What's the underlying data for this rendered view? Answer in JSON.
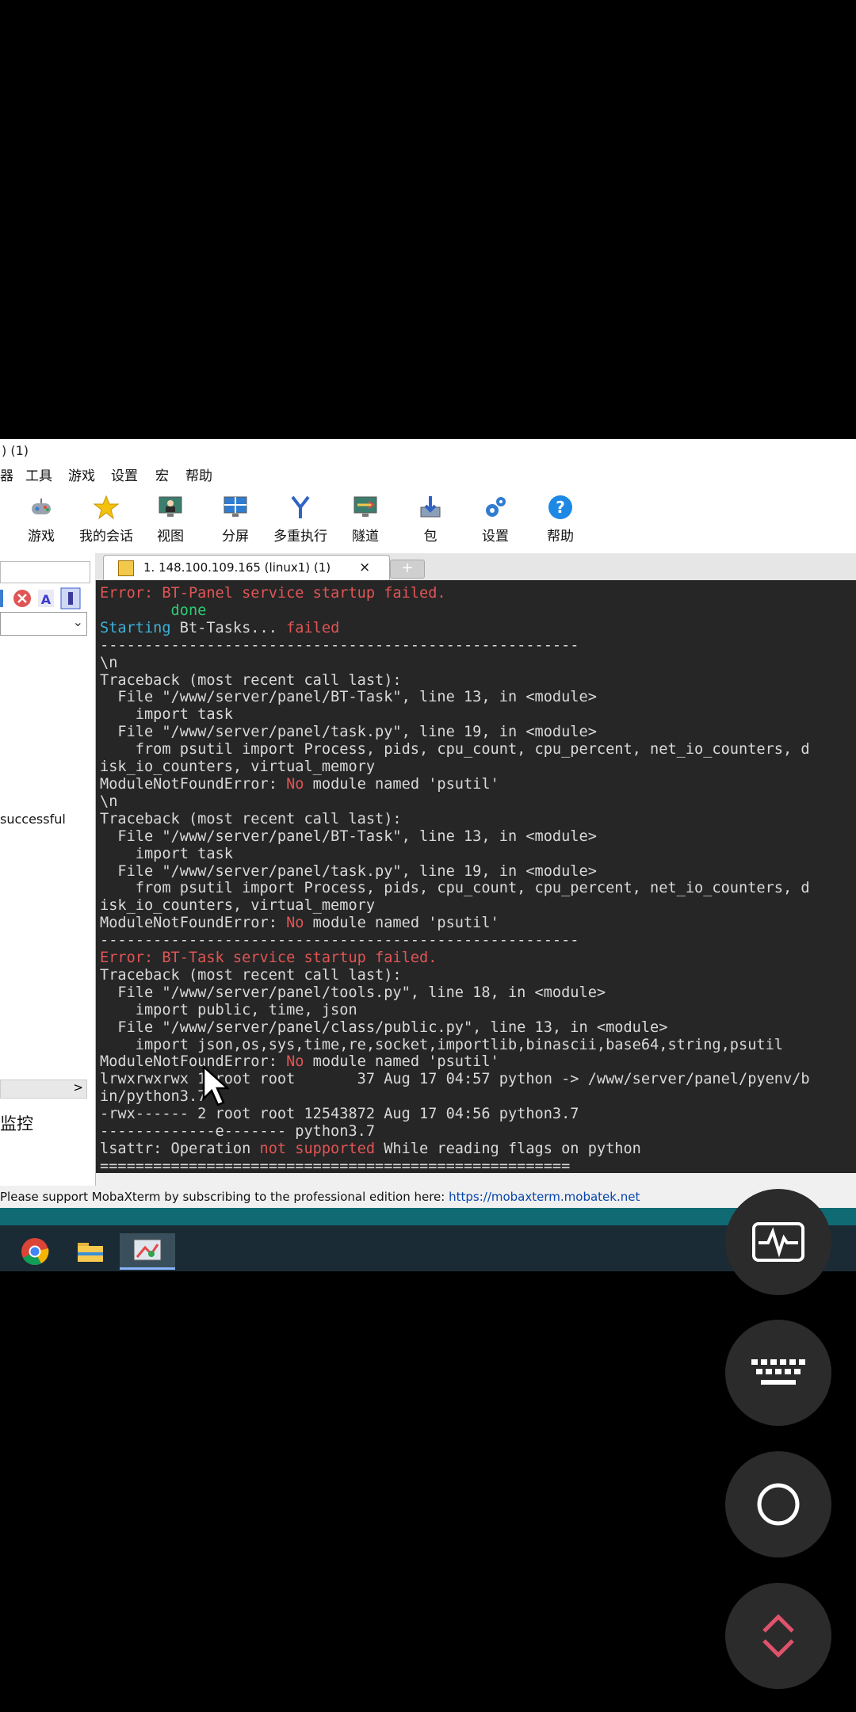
{
  "window": {
    "title": ") (1)"
  },
  "menu": [
    "器",
    "工具",
    "游戏",
    "设置",
    "宏",
    "帮助"
  ],
  "toolbar": [
    {
      "label": "游戏",
      "icon": "gamepad-icon"
    },
    {
      "label": "我的会话",
      "icon": "star-icon"
    },
    {
      "label": "视图",
      "icon": "monitor-user-icon"
    },
    {
      "label": "分屏",
      "icon": "split-screen-icon"
    },
    {
      "label": "多重执行",
      "icon": "fork-icon"
    },
    {
      "label": "隧道",
      "icon": "tunnel-icon"
    },
    {
      "label": "包",
      "icon": "package-icon"
    },
    {
      "label": "设置",
      "icon": "gears-icon"
    },
    {
      "label": "帮助",
      "icon": "help-icon"
    }
  ],
  "sidebar": {
    "status_text": "successful",
    "bottom_label": "监控",
    "scroll_arrow": ">"
  },
  "tabs": [
    {
      "label": "1. 148.100.109.165 (linux1) (1)",
      "close": "×"
    }
  ],
  "new_tab": "+",
  "terminal": {
    "lines": [
      [
        {
          "t": "Error: BT-Panel service startup failed.",
          "c": "r"
        }
      ],
      [
        {
          "t": "        done",
          "c": "g"
        }
      ],
      [
        {
          "t": "Starting ",
          "c": "c"
        },
        {
          "t": "Bt-Tasks... "
        },
        {
          "t": "failed",
          "c": "r"
        }
      ],
      [
        {
          "t": "------------------------------------------------------"
        }
      ],
      [
        {
          "t": "\\n"
        }
      ],
      [
        {
          "t": "Traceback (most recent call last):"
        }
      ],
      [
        {
          "t": "  File \"/www/server/panel/BT-Task\", line 13, in <module>"
        }
      ],
      [
        {
          "t": "    import task"
        }
      ],
      [
        {
          "t": "  File \"/www/server/panel/task.py\", line 19, in <module>"
        }
      ],
      [
        {
          "t": "    from psutil import Process, pids, cpu_count, cpu_percent, net_io_counters, d"
        }
      ],
      [
        {
          "t": "isk_io_counters, virtual_memory"
        }
      ],
      [
        {
          "t": "ModuleNotFoundError: "
        },
        {
          "t": "No",
          "c": "r"
        },
        {
          "t": " module named 'psutil'"
        }
      ],
      [
        {
          "t": "\\n"
        }
      ],
      [
        {
          "t": "Traceback (most recent call last):"
        }
      ],
      [
        {
          "t": "  File \"/www/server/panel/BT-Task\", line 13, in <module>"
        }
      ],
      [
        {
          "t": "    import task"
        }
      ],
      [
        {
          "t": "  File \"/www/server/panel/task.py\", line 19, in <module>"
        }
      ],
      [
        {
          "t": "    from psutil import Process, pids, cpu_count, cpu_percent, net_io_counters, d"
        }
      ],
      [
        {
          "t": "isk_io_counters, virtual_memory"
        }
      ],
      [
        {
          "t": "ModuleNotFoundError: "
        },
        {
          "t": "No",
          "c": "r"
        },
        {
          "t": " module named 'psutil'"
        }
      ],
      [
        {
          "t": "------------------------------------------------------"
        }
      ],
      [
        {
          "t": "Error: BT-Task service startup failed.",
          "c": "r"
        }
      ],
      [
        {
          "t": "Traceback (most recent call last):"
        }
      ],
      [
        {
          "t": "  File \"/www/server/panel/tools.py\", line 18, in <module>"
        }
      ],
      [
        {
          "t": "    import public, time, json"
        }
      ],
      [
        {
          "t": "  File \"/www/server/panel/class/public.py\", line 13, in <module>"
        }
      ],
      [
        {
          "t": "    import json,os,sys,time,re,socket,importlib,binascii,base64,string,psutil"
        }
      ],
      [
        {
          "t": "ModuleNotFoundError: "
        },
        {
          "t": "No",
          "c": "r"
        },
        {
          "t": " module named 'psutil'"
        }
      ],
      [
        {
          "t": "lrwxrwxrwx 1 root root       37 Aug 17 04:57 python -> /www/server/panel/pyenv/b"
        }
      ],
      [
        {
          "t": "in/python3.7"
        }
      ],
      [
        {
          "t": "-rwx------ 2 root root 12543872 Aug 17 04:56 python3.7"
        }
      ],
      [
        {
          "t": "-------------e------- python3.7"
        }
      ],
      [
        {
          "t": "lsattr: Operation "
        },
        {
          "t": "not supported",
          "c": "r"
        },
        {
          "t": " While reading flags on python"
        }
      ],
      [
        {
          "t": "====================================================="
        }
      ]
    ]
  },
  "statusbar": {
    "text": "Please support MobaXterm by subscribing to the professional edition here: ",
    "link": "https://mobaxterm.mobatek.net"
  },
  "taskbar": [
    "chrome-icon",
    "file-explorer-icon",
    "mobaxterm-icon"
  ],
  "floating_buttons": [
    "activity-monitor-icon",
    "keyboard-icon",
    "circle-icon",
    "up-down-arrows-icon"
  ],
  "colors": {
    "terminal_bg": "#262626",
    "error": "#e05555",
    "ok": "#2ecc71",
    "info": "#3fb0d8",
    "taskbar_accent": "#0f6a74"
  }
}
